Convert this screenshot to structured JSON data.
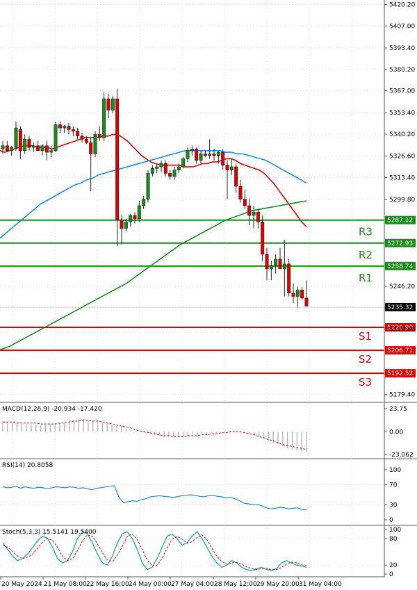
{
  "chart_data": [
    {
      "panel": "price",
      "type": "candlestick",
      "symbol_levels": {
        "resistance": [
          {
            "label": "R3",
            "value": 5287.12
          },
          {
            "label": "R2",
            "value": 5272.93
          },
          {
            "label": "R1",
            "value": 5258.74
          }
        ],
        "support": [
          {
            "label": "S1",
            "value": 5220.9
          },
          {
            "label": "S2",
            "value": 5206.71
          },
          {
            "label": "S3",
            "value": 5192.52
          }
        ],
        "level_labels": {
          "R3": "5287.12",
          "R2": "5272.93",
          "R1": "5258.74",
          "S1": "5220.90",
          "S2": "5206.71",
          "S3": "5192.52"
        }
      },
      "current_price": 5235.32,
      "current_price_label": "5235.32",
      "y_ticks": [
        "5420.20",
        "5407.00",
        "5393.40",
        "5380.20",
        "5367.00",
        "5353.40",
        "5340.20",
        "5326.60",
        "5313.40",
        "5299.80",
        "5246.20",
        "5233.00",
        "5219.80",
        "5179.40"
      ],
      "y_tick_values": [
        5420.2,
        5407.0,
        5393.4,
        5380.2,
        5367.0,
        5353.4,
        5340.2,
        5326.6,
        5313.4,
        5299.8,
        5246.2,
        5233.0,
        5219.8,
        5179.4
      ],
      "ylim": [
        5175,
        5423
      ],
      "x_tick_labels": [
        "20 May 2024",
        "21 May 08:00",
        "22 May 16:00",
        "24 May 00:00",
        "27 May 04:00",
        "28 May 12:00",
        "29 May 20:00",
        "31 May 04:00"
      ],
      "candles": [
        {
          "o": 5331,
          "h": 5336,
          "l": 5328,
          "c": 5333
        },
        {
          "o": 5333,
          "h": 5336,
          "l": 5329,
          "c": 5330
        },
        {
          "o": 5330,
          "h": 5333,
          "l": 5327,
          "c": 5332
        },
        {
          "o": 5332,
          "h": 5348,
          "l": 5330,
          "c": 5344
        },
        {
          "o": 5343,
          "h": 5345,
          "l": 5325,
          "c": 5330
        },
        {
          "o": 5330,
          "h": 5340,
          "l": 5328,
          "c": 5337
        },
        {
          "o": 5337,
          "h": 5339,
          "l": 5330,
          "c": 5332
        },
        {
          "o": 5332,
          "h": 5335,
          "l": 5329,
          "c": 5333
        },
        {
          "o": 5333,
          "h": 5336,
          "l": 5330,
          "c": 5330
        },
        {
          "o": 5330,
          "h": 5334,
          "l": 5327,
          "c": 5333
        },
        {
          "o": 5333,
          "h": 5336,
          "l": 5324,
          "c": 5329
        },
        {
          "o": 5329,
          "h": 5333,
          "l": 5326,
          "c": 5330
        },
        {
          "o": 5330,
          "h": 5348,
          "l": 5329,
          "c": 5346
        },
        {
          "o": 5346,
          "h": 5348,
          "l": 5341,
          "c": 5344
        },
        {
          "o": 5344,
          "h": 5346,
          "l": 5341,
          "c": 5345
        },
        {
          "o": 5345,
          "h": 5347,
          "l": 5340,
          "c": 5343
        },
        {
          "o": 5343,
          "h": 5345,
          "l": 5339,
          "c": 5342
        },
        {
          "o": 5342,
          "h": 5344,
          "l": 5337,
          "c": 5339
        },
        {
          "o": 5339,
          "h": 5341,
          "l": 5335,
          "c": 5337
        },
        {
          "o": 5337,
          "h": 5339,
          "l": 5334,
          "c": 5335
        },
        {
          "o": 5335,
          "h": 5338,
          "l": 5305,
          "c": 5328
        },
        {
          "o": 5328,
          "h": 5342,
          "l": 5326,
          "c": 5340
        },
        {
          "o": 5340,
          "h": 5345,
          "l": 5336,
          "c": 5338
        },
        {
          "o": 5338,
          "h": 5366,
          "l": 5336,
          "c": 5362
        },
        {
          "o": 5362,
          "h": 5365,
          "l": 5350,
          "c": 5355
        },
        {
          "o": 5355,
          "h": 5364,
          "l": 5353,
          "c": 5362
        },
        {
          "o": 5362,
          "h": 5368,
          "l": 5271,
          "c": 5287
        },
        {
          "o": 5287,
          "h": 5290,
          "l": 5272,
          "c": 5282
        },
        {
          "o": 5282,
          "h": 5288,
          "l": 5280,
          "c": 5286
        },
        {
          "o": 5286,
          "h": 5291,
          "l": 5283,
          "c": 5290
        },
        {
          "o": 5290,
          "h": 5292,
          "l": 5285,
          "c": 5288
        },
        {
          "o": 5288,
          "h": 5299,
          "l": 5286,
          "c": 5296
        },
        {
          "o": 5296,
          "h": 5302,
          "l": 5294,
          "c": 5300
        },
        {
          "o": 5300,
          "h": 5318,
          "l": 5298,
          "c": 5316
        },
        {
          "o": 5316,
          "h": 5321,
          "l": 5314,
          "c": 5319
        },
        {
          "o": 5319,
          "h": 5322,
          "l": 5316,
          "c": 5320
        },
        {
          "o": 5320,
          "h": 5324,
          "l": 5317,
          "c": 5322
        },
        {
          "o": 5322,
          "h": 5324,
          "l": 5314,
          "c": 5316
        },
        {
          "o": 5316,
          "h": 5318,
          "l": 5312,
          "c": 5314
        },
        {
          "o": 5314,
          "h": 5320,
          "l": 5312,
          "c": 5318
        },
        {
          "o": 5318,
          "h": 5322,
          "l": 5316,
          "c": 5320
        },
        {
          "o": 5320,
          "h": 5326,
          "l": 5319,
          "c": 5325
        },
        {
          "o": 5325,
          "h": 5332,
          "l": 5323,
          "c": 5330
        },
        {
          "o": 5330,
          "h": 5333,
          "l": 5327,
          "c": 5331
        },
        {
          "o": 5331,
          "h": 5332,
          "l": 5322,
          "c": 5324
        },
        {
          "o": 5324,
          "h": 5330,
          "l": 5322,
          "c": 5328
        },
        {
          "o": 5328,
          "h": 5330,
          "l": 5326,
          "c": 5327
        },
        {
          "o": 5327,
          "h": 5337,
          "l": 5325,
          "c": 5328
        },
        {
          "o": 5328,
          "h": 5331,
          "l": 5324,
          "c": 5327
        },
        {
          "o": 5327,
          "h": 5330,
          "l": 5322,
          "c": 5329
        },
        {
          "o": 5329,
          "h": 5331,
          "l": 5318,
          "c": 5321
        },
        {
          "o": 5321,
          "h": 5324,
          "l": 5300,
          "c": 5318
        },
        {
          "o": 5318,
          "h": 5325,
          "l": 5315,
          "c": 5320
        },
        {
          "o": 5320,
          "h": 5322,
          "l": 5304,
          "c": 5308
        },
        {
          "o": 5308,
          "h": 5312,
          "l": 5298,
          "c": 5300
        },
        {
          "o": 5300,
          "h": 5306,
          "l": 5294,
          "c": 5296
        },
        {
          "o": 5296,
          "h": 5300,
          "l": 5284,
          "c": 5290
        },
        {
          "o": 5290,
          "h": 5296,
          "l": 5282,
          "c": 5292
        },
        {
          "o": 5292,
          "h": 5294,
          "l": 5282,
          "c": 5286
        },
        {
          "o": 5286,
          "h": 5290,
          "l": 5262,
          "c": 5266
        },
        {
          "o": 5266,
          "h": 5270,
          "l": 5250,
          "c": 5257
        },
        {
          "o": 5257,
          "h": 5262,
          "l": 5250,
          "c": 5259
        },
        {
          "o": 5259,
          "h": 5266,
          "l": 5254,
          "c": 5263
        },
        {
          "o": 5263,
          "h": 5270,
          "l": 5258,
          "c": 5257
        },
        {
          "o": 5257,
          "h": 5275,
          "l": 5240,
          "c": 5260
        },
        {
          "o": 5260,
          "h": 5263,
          "l": 5240,
          "c": 5242
        },
        {
          "o": 5242,
          "h": 5248,
          "l": 5236,
          "c": 5240
        },
        {
          "o": 5240,
          "h": 5246,
          "l": 5233,
          "c": 5244
        },
        {
          "o": 5244,
          "h": 5246,
          "l": 5238,
          "c": 5239
        },
        {
          "o": 5239,
          "h": 5250,
          "l": 5234,
          "c": 5234
        }
      ],
      "moving_averages": [
        {
          "color": "#e00000",
          "values": [
            5330,
            5329,
            5330,
            5331,
            5332,
            5333,
            5333,
            5333,
            5332,
            5332,
            5332,
            5331,
            5332,
            5333,
            5334,
            5335,
            5336,
            5337,
            5338,
            5338,
            5338,
            5338,
            5339,
            5339,
            5340,
            5340,
            5338,
            5336,
            5333,
            5330,
            5327,
            5325,
            5323,
            5322,
            5321,
            5321,
            5321,
            5321,
            5321,
            5320,
            5320,
            5320,
            5321,
            5322,
            5322,
            5323,
            5323,
            5324,
            5325,
            5325,
            5324,
            5322,
            5321,
            5320,
            5319,
            5318,
            5316,
            5313,
            5310,
            5306,
            5302,
            5298,
            5294,
            5290,
            5286,
            5283
          ]
        },
        {
          "color": "#1a8be8",
          "values": [
            5276,
            5279,
            5282,
            5285,
            5288,
            5291,
            5294,
            5297,
            5299,
            5301,
            5303,
            5305,
            5307,
            5309,
            5310,
            5312,
            5313,
            5315,
            5316,
            5317,
            5318,
            5319,
            5320,
            5321,
            5322,
            5323,
            5324,
            5325,
            5326,
            5327,
            5328,
            5329,
            5330,
            5330,
            5330,
            5330,
            5330,
            5330,
            5330,
            5329,
            5329,
            5328,
            5328,
            5327,
            5326,
            5325,
            5324,
            5322,
            5320,
            5318,
            5316,
            5314,
            5312,
            5310
          ]
        },
        {
          "color": "#1a8c1a",
          "values": [
            5207,
            5209,
            5212,
            5215,
            5218,
            5221,
            5224,
            5227,
            5230,
            5233,
            5236,
            5239,
            5242,
            5245,
            5248,
            5252,
            5256,
            5260,
            5264,
            5268,
            5272,
            5275,
            5278,
            5281,
            5284,
            5287,
            5289,
            5291,
            5293,
            5294,
            5295,
            5296,
            5297,
            5298,
            5299
          ]
        }
      ]
    },
    {
      "panel": "macd",
      "type": "bar",
      "title": "MACD(12,26,9) -20.934 -17.420",
      "y_ticks": [
        "23.75",
        "0.00",
        "-23.062"
      ],
      "y_tick_values": [
        23.75,
        0.0,
        -23.062
      ],
      "ylim": [
        -26,
        28
      ],
      "histogram": [
        11,
        10,
        9,
        9,
        8,
        8,
        8,
        7,
        7,
        7,
        7,
        8,
        9,
        10,
        11,
        12,
        13,
        13,
        12,
        11,
        10,
        9,
        8,
        7,
        6,
        5,
        3,
        2,
        1,
        0,
        -1,
        -2,
        -3,
        -4,
        -5,
        -5,
        -5,
        -5,
        -4,
        -4,
        -3,
        -3,
        -2,
        -2,
        -1,
        -1,
        0,
        0,
        1,
        1,
        0,
        -1,
        -2,
        -3,
        -5,
        -7,
        -9,
        -11,
        -13,
        -15,
        -17,
        -18,
        -19,
        -20,
        -21
      ],
      "signal": [
        10,
        10,
        10,
        9,
        9,
        9,
        9,
        9,
        8,
        8,
        8,
        8,
        9,
        9,
        10,
        11,
        11,
        12,
        12,
        11,
        11,
        10,
        9,
        8,
        7,
        6,
        5,
        4,
        2,
        1,
        0,
        -1,
        -2,
        -3,
        -4,
        -4,
        -5,
        -5,
        -5,
        -4,
        -4,
        -4,
        -3,
        -3,
        -2,
        -2,
        -1,
        -1,
        0,
        0,
        0,
        -1,
        -2,
        -3,
        -5,
        -6,
        -8,
        -9,
        -11,
        -13,
        -14,
        -15,
        -16,
        -17,
        -18
      ]
    },
    {
      "panel": "rsi",
      "type": "line",
      "title": "RSI(14) 20.8058",
      "y_ticks": [
        "100",
        "70",
        "30",
        "0"
      ],
      "y_tick_values": [
        100,
        70,
        30,
        0
      ],
      "ylim": [
        0,
        100
      ],
      "values": [
        66,
        64,
        65,
        67,
        63,
        66,
        64,
        63,
        65,
        64,
        62,
        64,
        66,
        65,
        64,
        66,
        65,
        63,
        64,
        62,
        60,
        63,
        64,
        66,
        67,
        68,
        45,
        34,
        36,
        38,
        37,
        40,
        42,
        46,
        47,
        48,
        47,
        46,
        45,
        46,
        48,
        49,
        50,
        49,
        47,
        46,
        48,
        49,
        47,
        46,
        44,
        45,
        42,
        38,
        33,
        32,
        30,
        31,
        28,
        24,
        22,
        23,
        25,
        24,
        22,
        23,
        24,
        21,
        20
      ]
    },
    {
      "panel": "stoch",
      "type": "line",
      "title": "Stoch(5,3,3) 15.5141 19.5400",
      "y_ticks": [
        "100",
        "80",
        "20",
        "0"
      ],
      "y_tick_values": [
        100,
        80,
        20,
        0
      ],
      "ylim": [
        0,
        100
      ],
      "k": [
        70,
        55,
        40,
        30,
        35,
        45,
        60,
        75,
        85,
        80,
        60,
        35,
        25,
        30,
        50,
        80,
        95,
        90,
        70,
        45,
        25,
        20,
        40,
        70,
        90,
        95,
        80,
        55,
        25,
        10,
        15,
        35,
        60,
        85,
        90,
        80,
        65,
        70,
        85,
        95,
        80,
        60,
        40,
        25,
        15,
        20,
        30,
        25,
        15,
        10,
        8,
        12,
        15,
        10,
        8,
        12,
        25,
        30,
        25,
        20,
        18,
        15
      ],
      "d": [
        65,
        60,
        50,
        40,
        35,
        38,
        45,
        58,
        72,
        80,
        75,
        60,
        40,
        30,
        35,
        52,
        75,
        88,
        85,
        68,
        48,
        32,
        28,
        42,
        62,
        85,
        90,
        78,
        55,
        32,
        18,
        20,
        35,
        58,
        78,
        85,
        78,
        70,
        72,
        82,
        88,
        78,
        58,
        40,
        28,
        22,
        25,
        26,
        22,
        16,
        12,
        10,
        12,
        12,
        10,
        10,
        15,
        22,
        27,
        25,
        21,
        18
      ]
    }
  ]
}
